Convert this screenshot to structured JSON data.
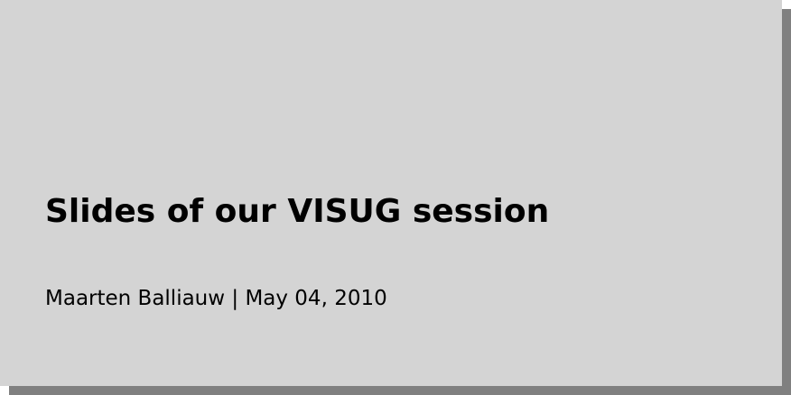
{
  "card": {
    "title": "Slides of our VISUG session",
    "byline": "Maarten Balliauw | May 04, 2010"
  },
  "colors": {
    "card_background": "#d4d4d4",
    "shadow": "#808080",
    "text": "#000000"
  }
}
